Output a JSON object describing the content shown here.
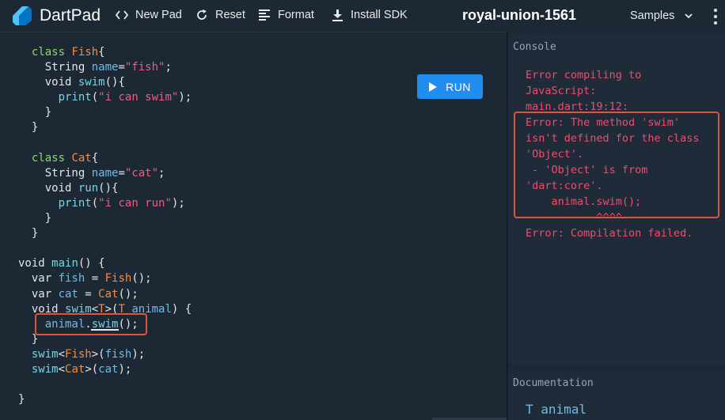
{
  "header": {
    "brand": "DartPad",
    "new_pad": "New Pad",
    "reset": "Reset",
    "format": "Format",
    "install_sdk": "Install SDK",
    "pad_title": "royal-union-1561",
    "samples": "Samples"
  },
  "editor": {
    "run_label": "RUN",
    "lines": [
      [
        {
          "t": "  "
        },
        {
          "t": "class ",
          "c": "grn"
        },
        {
          "t": "Fish",
          "c": "cls"
        },
        {
          "t": "{"
        }
      ],
      [
        {
          "t": "    String "
        },
        {
          "t": "name",
          "c": "var"
        },
        {
          "t": "="
        },
        {
          "t": "\"fish\"",
          "c": "str"
        },
        {
          "t": ";"
        }
      ],
      [
        {
          "t": "    void "
        },
        {
          "t": "swim",
          "c": "fn"
        },
        {
          "t": "(){"
        }
      ],
      [
        {
          "t": "      "
        },
        {
          "t": "print",
          "c": "fn"
        },
        {
          "t": "("
        },
        {
          "t": "\"i can swim\"",
          "c": "str"
        },
        {
          "t": ");"
        }
      ],
      [
        {
          "t": "    }"
        }
      ],
      [
        {
          "t": "  }"
        }
      ],
      [
        {
          "t": ""
        }
      ],
      [
        {
          "t": "  "
        },
        {
          "t": "class ",
          "c": "grn"
        },
        {
          "t": "Cat",
          "c": "cls"
        },
        {
          "t": "{"
        }
      ],
      [
        {
          "t": "    String "
        },
        {
          "t": "name",
          "c": "var"
        },
        {
          "t": "="
        },
        {
          "t": "\"cat\"",
          "c": "str"
        },
        {
          "t": ";"
        }
      ],
      [
        {
          "t": "    void "
        },
        {
          "t": "run",
          "c": "fn"
        },
        {
          "t": "(){"
        }
      ],
      [
        {
          "t": "      "
        },
        {
          "t": "print",
          "c": "fn"
        },
        {
          "t": "("
        },
        {
          "t": "\"i can run\"",
          "c": "str"
        },
        {
          "t": ");"
        }
      ],
      [
        {
          "t": "    }"
        }
      ],
      [
        {
          "t": "  }"
        }
      ],
      [
        {
          "t": ""
        }
      ],
      [
        {
          "t": "void "
        },
        {
          "t": "main",
          "c": "fn"
        },
        {
          "t": "() {"
        }
      ],
      [
        {
          "t": "  var "
        },
        {
          "t": "fish",
          "c": "var"
        },
        {
          "t": " = "
        },
        {
          "t": "Fish",
          "c": "cls"
        },
        {
          "t": "();"
        }
      ],
      [
        {
          "t": "  var "
        },
        {
          "t": "cat",
          "c": "var"
        },
        {
          "t": " = "
        },
        {
          "t": "Cat",
          "c": "cls"
        },
        {
          "t": "();"
        }
      ],
      [
        {
          "t": "  void "
        },
        {
          "t": "swim",
          "c": "fn"
        },
        {
          "t": "<"
        },
        {
          "t": "T",
          "c": "cls"
        },
        {
          "t": ">("
        },
        {
          "t": "T",
          "c": "cls"
        },
        {
          "t": " "
        },
        {
          "t": "animal",
          "c": "var"
        },
        {
          "t": ") {"
        }
      ],
      [
        {
          "t": "    "
        },
        {
          "t": "animal",
          "c": "var"
        },
        {
          "t": "."
        },
        {
          "t": "swim",
          "c": "fn"
        },
        {
          "t": "();"
        }
      ],
      [
        {
          "t": "  }"
        }
      ],
      [
        {
          "t": "  "
        },
        {
          "t": "swim",
          "c": "fn"
        },
        {
          "t": "<"
        },
        {
          "t": "Fish",
          "c": "cls"
        },
        {
          "t": ">("
        },
        {
          "t": "fish",
          "c": "var"
        },
        {
          "t": ");"
        }
      ],
      [
        {
          "t": "  "
        },
        {
          "t": "swim",
          "c": "fn"
        },
        {
          "t": "<"
        },
        {
          "t": "Cat",
          "c": "cls"
        },
        {
          "t": ">("
        },
        {
          "t": "cat",
          "c": "var"
        },
        {
          "t": ");"
        }
      ],
      [
        {
          "t": ""
        }
      ],
      [
        {
          "t": "}"
        }
      ]
    ]
  },
  "console": {
    "label": "Console",
    "text": "Error compiling to\nJavaScript:\nmain.dart:19:12:\nError: The method 'swim'\nisn't defined for the class\n'Object'.\n - 'Object' is from\n'dart:core'.\n    animal.swim();\n           ^^^^\nError: Compilation failed."
  },
  "documentation": {
    "label": "Documentation",
    "text": "T animal"
  },
  "colors": {
    "accent": "#1f8ef0",
    "error": "#e94f6f",
    "highlight_box": "#e1533a"
  }
}
